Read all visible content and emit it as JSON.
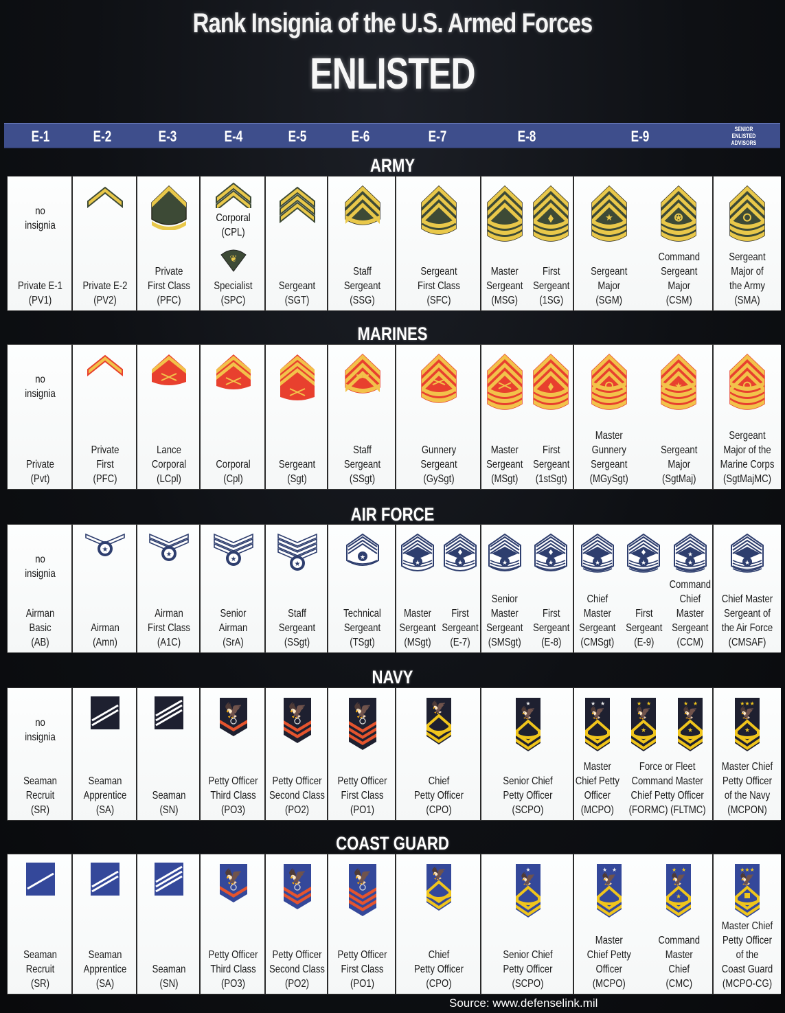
{
  "title": "Rank Insignia of the U.S. Armed Forces",
  "subtitle": "ENLISTED",
  "grades": [
    "E-1",
    "E-2",
    "E-3",
    "E-4",
    "E-5",
    "E-6",
    "E-7",
    "E-8",
    "E-9",
    "SENIOR\nENLISTED\nADVISORS"
  ],
  "colors": {
    "grade_bar": "#3e4e8c",
    "army_gold": "#e9c84a",
    "army_green": "#3d4a36",
    "marine_red": "#e8402e",
    "marine_gold": "#f2c24a",
    "airforce_blue": "#2e3e6e",
    "navy_dark": "#1e2030",
    "navy_red": "#e5542e",
    "navy_gold": "#f0c51c",
    "cg_blue": "#34489a"
  },
  "services": [
    {
      "name": "ARMY",
      "cells": [
        {
          "grade": "E-1",
          "items": [
            {
              "insignia": "none-icon",
              "no_insignia": "no\ninsignia",
              "label": "Private E-1\n(PV1)"
            }
          ]
        },
        {
          "grade": "E-2",
          "items": [
            {
              "insignia": "chevron-1-icon",
              "label": "Private E-2\n(PV2)"
            }
          ]
        },
        {
          "grade": "E-3",
          "items": [
            {
              "insignia": "chevron-1-rocker-icon",
              "label": "Private\nFirst Class\n(PFC)"
            }
          ]
        },
        {
          "grade": "E-4",
          "items": [
            {
              "insignia": "chevron-2-icon",
              "mid_label": "Corporal\n(CPL)",
              "alt_insignia": "specialist-eagle-icon",
              "label": "Specialist\n(SPC)"
            }
          ]
        },
        {
          "grade": "E-5",
          "items": [
            {
              "insignia": "chevron-3-icon",
              "label": "Sergeant\n(SGT)"
            }
          ]
        },
        {
          "grade": "E-6",
          "items": [
            {
              "insignia": "chevron-3-rocker-1-icon",
              "label": "Staff\nSergeant\n(SSG)"
            }
          ]
        },
        {
          "grade": "E-7",
          "items": [
            {
              "insignia": "chevron-3-rocker-2-icon",
              "label": "Sergeant\nFirst Class\n(SFC)"
            }
          ]
        },
        {
          "grade": "E-8",
          "items": [
            {
              "insignia": "chevron-3-rocker-3-icon",
              "label": "Master\nSergeant\n(MSG)"
            },
            {
              "insignia": "chevron-3-rocker-3-diamond-icon",
              "label": "First\nSergeant\n(1SG)"
            }
          ]
        },
        {
          "grade": "E-9",
          "items": [
            {
              "insignia": "chevron-3-rocker-3-star-icon",
              "label": "Sergeant\nMajor\n(SGM)"
            },
            {
              "insignia": "chevron-3-rocker-3-wreath-star-icon",
              "label": "Command\nSergeant\nMajor\n(CSM)"
            }
          ]
        },
        {
          "grade": "SEA",
          "items": [
            {
              "insignia": "chevron-3-rocker-3-eagle-icon",
              "label": "Sergeant\nMajor of\nthe Army\n(SMA)"
            }
          ]
        }
      ]
    },
    {
      "name": "MARINES",
      "cells": [
        {
          "grade": "E-1",
          "items": [
            {
              "insignia": "none-icon",
              "no_insignia": "no\ninsignia",
              "label": "Private\n(Pvt)"
            }
          ]
        },
        {
          "grade": "E-2",
          "items": [
            {
              "insignia": "chevron-1-icon",
              "label": "Private\nFirst\n(PFC)"
            }
          ]
        },
        {
          "grade": "E-3",
          "items": [
            {
              "insignia": "chevron-1-rifles-icon",
              "label": "Lance\nCorporal\n(LCpl)"
            }
          ]
        },
        {
          "grade": "E-4",
          "items": [
            {
              "insignia": "chevron-2-rifles-icon",
              "label": "Corporal\n(Cpl)"
            }
          ]
        },
        {
          "grade": "E-5",
          "items": [
            {
              "insignia": "chevron-3-rifles-icon",
              "label": "Sergeant\n(Sgt)"
            }
          ]
        },
        {
          "grade": "E-6",
          "items": [
            {
              "insignia": "chevron-3-rocker-1-rifles-icon",
              "label": "Staff\nSergeant\n(SSgt)"
            }
          ]
        },
        {
          "grade": "E-7",
          "items": [
            {
              "insignia": "chevron-3-rocker-2-rifles-icon",
              "label": "Gunnery\nSergeant\n(GySgt)"
            }
          ]
        },
        {
          "grade": "E-8",
          "items": [
            {
              "insignia": "chevron-3-rocker-3-rifles-icon",
              "label": "Master\nSergeant\n(MSgt)"
            },
            {
              "insignia": "chevron-3-rocker-3-diamond-icon",
              "label": "First\nSergeant\n(1stSgt)"
            }
          ]
        },
        {
          "grade": "E-9",
          "items": [
            {
              "insignia": "chevron-3-rocker-4-bomb-icon",
              "label": "Master\nGunnery\nSergeant\n(MGySgt)"
            },
            {
              "insignia": "chevron-3-rocker-4-star-icon",
              "label": "Sergeant\nMajor\n(SgtMaj)"
            }
          ]
        },
        {
          "grade": "SEA",
          "items": [
            {
              "insignia": "chevron-3-rocker-4-ega-icon",
              "label": "Sergeant\nMajor of the\nMarine Corps\n(SgtMajMC)"
            }
          ]
        }
      ]
    },
    {
      "name": "AIR FORCE",
      "cells": [
        {
          "grade": "E-1",
          "items": [
            {
              "insignia": "none-icon",
              "no_insignia": "no\ninsignia",
              "label": "Airman\nBasic\n(AB)"
            }
          ]
        },
        {
          "grade": "E-2",
          "items": [
            {
              "insignia": "af-star-1-stripe-icon",
              "label": "Airman\n(Amn)"
            }
          ]
        },
        {
          "grade": "E-3",
          "items": [
            {
              "insignia": "af-star-2-stripe-icon",
              "label": "Airman\nFirst Class\n(A1C)"
            }
          ]
        },
        {
          "grade": "E-4",
          "items": [
            {
              "insignia": "af-star-3-stripe-icon",
              "label": "Senior\nAirman\n(SrA)"
            }
          ]
        },
        {
          "grade": "E-5",
          "items": [
            {
              "insignia": "af-star-4-stripe-icon",
              "label": "Staff\nSergeant\n(SSgt)"
            }
          ]
        },
        {
          "grade": "E-6",
          "items": [
            {
              "insignia": "af-star-5-stripe-icon",
              "label": "Technical\nSergeant\n(TSgt)"
            }
          ]
        },
        {
          "grade": "E-7",
          "items": [
            {
              "insignia": "af-star-6-stripe-icon",
              "label": "Master\nSergeant\n(MSgt)"
            },
            {
              "insignia": "af-star-6-stripe-diamond-icon",
              "label": "First\nSergeant\n(E-7)"
            }
          ]
        },
        {
          "grade": "E-8",
          "items": [
            {
              "insignia": "af-star-7-stripe-icon",
              "label": "Senior\nMaster\nSergeant\n(SMSgt)"
            },
            {
              "insignia": "af-star-7-stripe-diamond-icon",
              "label": "First\nSergeant\n(E-8)"
            }
          ]
        },
        {
          "grade": "E-9",
          "items": [
            {
              "insignia": "af-star-8-stripe-icon",
              "label": "Chief\nMaster\nSergeant\n(CMSgt)"
            },
            {
              "insignia": "af-star-8-stripe-diamond-icon",
              "label": "First\nSergeant\n(E-9)"
            },
            {
              "insignia": "af-star-8-stripe-star-icon",
              "label": "Command\nChief Master\nSergeant\n(CCM)"
            }
          ]
        },
        {
          "grade": "SEA",
          "items": [
            {
              "insignia": "af-wreath-8-stripe-icon",
              "label": "Chief Master\nSergeant of\nthe Air Force\n(CMSAF)"
            }
          ]
        }
      ]
    },
    {
      "name": "NAVY",
      "cells": [
        {
          "grade": "E-1",
          "items": [
            {
              "insignia": "none-icon",
              "no_insignia": "no\ninsignia",
              "label": "Seaman\nRecruit\n(SR)"
            }
          ]
        },
        {
          "grade": "E-2",
          "items": [
            {
              "insignia": "stripes-2-icon",
              "label": "Seaman\nApprentice\n(SA)"
            }
          ]
        },
        {
          "grade": "E-3",
          "items": [
            {
              "insignia": "stripes-3-icon",
              "label": "Seaman\n(SN)"
            }
          ]
        },
        {
          "grade": "E-4",
          "items": [
            {
              "insignia": "eagle-chevron-1-icon",
              "label": "Petty Officer\nThird Class\n(PO3)"
            }
          ]
        },
        {
          "grade": "E-5",
          "items": [
            {
              "insignia": "eagle-chevron-2-icon",
              "label": "Petty Officer\nSecond Class\n(PO2)"
            }
          ]
        },
        {
          "grade": "E-6",
          "items": [
            {
              "insignia": "eagle-chevron-3-icon",
              "label": "Petty Officer\nFirst Class\n(PO1)"
            }
          ]
        },
        {
          "grade": "E-7",
          "items": [
            {
              "insignia": "eagle-rocker-chevron-3-icon",
              "label": "Chief\nPetty Officer\n(CPO)"
            }
          ]
        },
        {
          "grade": "E-8",
          "items": [
            {
              "insignia": "eagle-rocker-1-star-icon",
              "label": "Senior Chief\nPetty Officer\n(SCPO)"
            }
          ]
        },
        {
          "grade": "E-9",
          "items": [
            {
              "insignia": "eagle-rocker-2-star-icon",
              "label": "Master\nChief Petty\nOfficer\n(MCPO)"
            },
            {
              "insignia": "eagle-rocker-2-gold-star-icon",
              "label": "Force or Fleet\nCommand Master\nChief Petty Officer\n(FORMC) (FLTMC)",
              "span": 2
            }
          ]
        },
        {
          "grade": "SEA",
          "items": [
            {
              "insignia": "eagle-rocker-3-gold-star-icon",
              "label": "Master Chief\nPetty Officer\nof the Navy\n(MCPON)"
            }
          ]
        }
      ]
    },
    {
      "name": "COAST GUARD",
      "cells": [
        {
          "grade": "E-1",
          "items": [
            {
              "insignia": "stripes-1-icon",
              "label": "Seaman\nRecruit\n(SR)"
            }
          ]
        },
        {
          "grade": "E-2",
          "items": [
            {
              "insignia": "stripes-2-icon",
              "label": "Seaman\nApprentice\n(SA)"
            }
          ]
        },
        {
          "grade": "E-3",
          "items": [
            {
              "insignia": "stripes-3-icon",
              "label": "Seaman\n(SN)"
            }
          ]
        },
        {
          "grade": "E-4",
          "items": [
            {
              "insignia": "eagle-chevron-1-icon",
              "label": "Petty Officer\nThird Class\n(PO3)"
            }
          ]
        },
        {
          "grade": "E-5",
          "items": [
            {
              "insignia": "eagle-chevron-2-icon",
              "label": "Petty Officer\nSecond Class\n(PO2)"
            }
          ]
        },
        {
          "grade": "E-6",
          "items": [
            {
              "insignia": "eagle-chevron-3-icon",
              "label": "Petty Officer\nFirst Class\n(PO1)"
            }
          ]
        },
        {
          "grade": "E-7",
          "items": [
            {
              "insignia": "eagle-rocker-chevron-3-icon",
              "label": "Chief\nPetty Officer\n(CPO)"
            }
          ]
        },
        {
          "grade": "E-8",
          "items": [
            {
              "insignia": "eagle-rocker-1-star-icon",
              "label": "Senior Chief\nPetty Officer\n(SCPO)"
            }
          ]
        },
        {
          "grade": "E-9",
          "items": [
            {
              "insignia": "eagle-rocker-2-star-icon",
              "label": "Master\nChief Petty\nOfficer\n(MCPO)"
            },
            {
              "insignia": "eagle-rocker-2-gold-star-icon",
              "label": "Command\nMaster\nChief\n(CMC)"
            }
          ]
        },
        {
          "grade": "SEA",
          "items": [
            {
              "insignia": "eagle-rocker-3-gold-star-shield-icon",
              "label": "Master Chief\nPetty Officer\nof the\nCoast Guard\n(MCPO-CG)"
            }
          ]
        }
      ]
    }
  ],
  "source": "Source: www.defenselink.mil"
}
